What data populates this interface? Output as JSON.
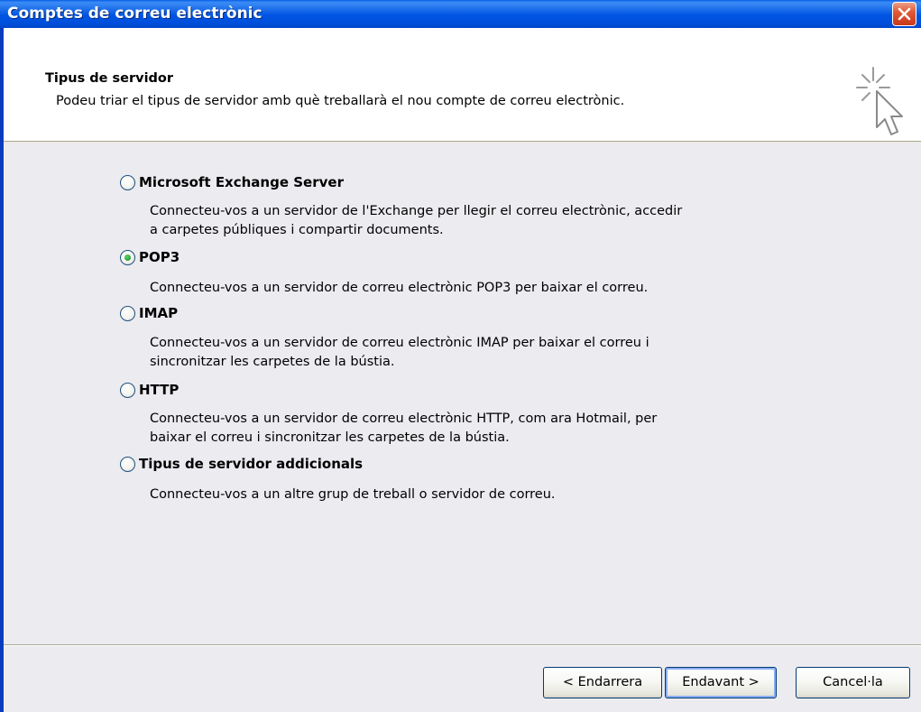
{
  "window": {
    "title": "Comptes de correu electrònic"
  },
  "header": {
    "title": "Tipus de servidor",
    "description": "Podeu triar el tipus de servidor amb què treballarà el nou compte de correu electrònic."
  },
  "options": [
    {
      "label": "Microsoft Exchange Server",
      "description": "Connecteu-vos a un servidor de l'Exchange per llegir el correu electrònic, accedir\na carpetes públiques i compartir documents.",
      "selected": false
    },
    {
      "label": "POP3",
      "description": "Connecteu-vos a un servidor de correu electrònic POP3 per baixar el correu.",
      "selected": true
    },
    {
      "label": "IMAP",
      "description": "Connecteu-vos a un servidor de correu electrònic IMAP per baixar el correu i\nsincronitzar les carpetes de la bústia.",
      "selected": false
    },
    {
      "label": "HTTP",
      "description": "Connecteu-vos a un servidor de correu electrònic HTTP, com ara Hotmail, per\nbaixar el correu i sincronitzar les carpetes de la bústia.",
      "selected": false
    },
    {
      "label": "Tipus de servidor addicionals",
      "description": "Connecteu-vos a un altre grup de treball o servidor de correu.",
      "selected": false
    }
  ],
  "buttons": {
    "back": "< Endarrera",
    "next": "Endavant >",
    "cancel": "Cancel·la"
  },
  "icons": {
    "close": "close-icon",
    "wizard": "cursor-sparkle-icon"
  },
  "colors": {
    "titlebar": "#0054e3",
    "close": "#e15a36",
    "dialog_bg": "#ecebf0",
    "header_bg": "#ffffff",
    "radio_selected": "#2fa83a"
  }
}
